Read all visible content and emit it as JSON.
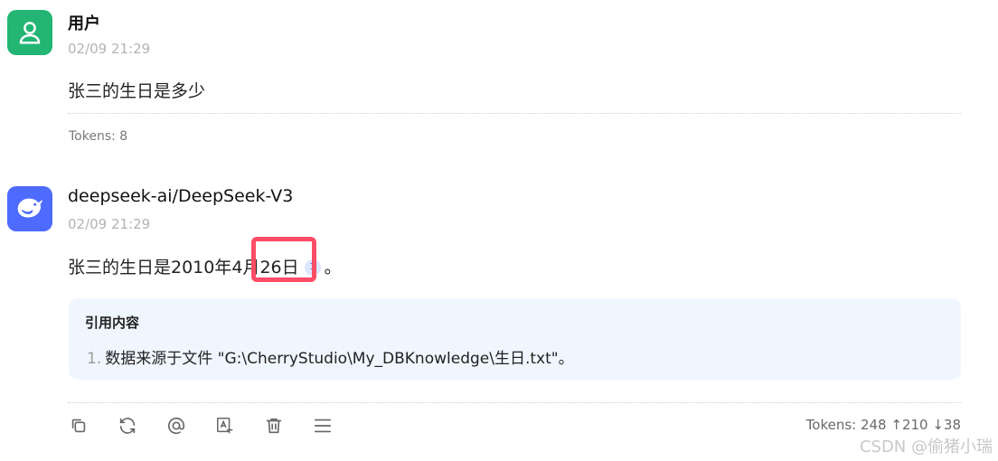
{
  "user_message": {
    "sender": "用户",
    "time": "02/09 21:29",
    "text": "张三的生日是多少",
    "tokens": "Tokens: 8"
  },
  "ai_message": {
    "sender": "deepseek-ai/DeepSeek-V3",
    "time": "02/09 21:29",
    "text_before": "张三的生日是2010年4月26日",
    "citation_number": "1",
    "text_after": "。",
    "reference": {
      "title": "引用内容",
      "items": [
        {
          "number": "1.",
          "text": "数据来源于文件 \"G:\\CherryStudio\\My_DBKnowledge\\生日.txt\"。"
        }
      ]
    },
    "toolbar": [
      "copy-icon",
      "regenerate-icon",
      "mention-icon",
      "translate-icon",
      "delete-icon",
      "menu-icon"
    ],
    "tokens": "Tokens: 248 ↑210 ↓38"
  },
  "watermark": "CSDN @偷猪小瑞",
  "colors": {
    "user_avatar": "#22b573",
    "ai_avatar": "#4d6bfe",
    "highlight": "#ff4d67",
    "reference_bg": "#f0f6ff"
  }
}
